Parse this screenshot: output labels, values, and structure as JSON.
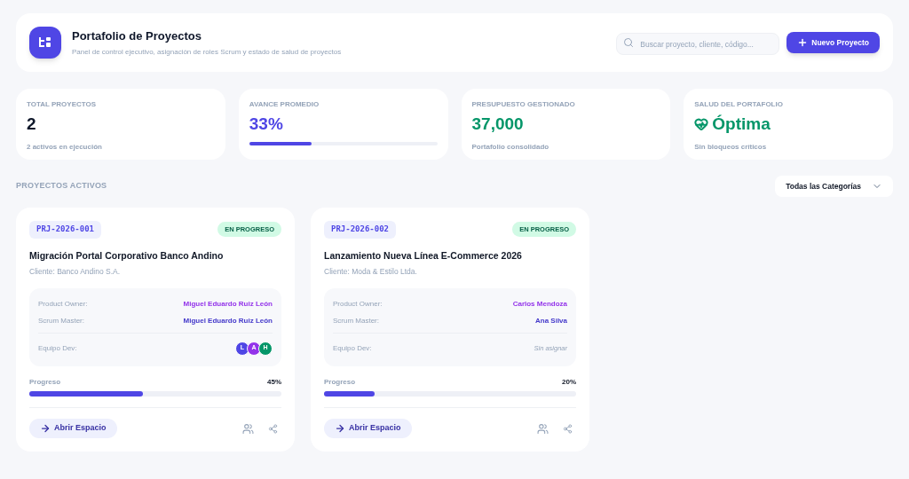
{
  "header": {
    "title": "Portafolio de Proyectos",
    "subtitle": "Panel de control ejecutivo, asignación de roles Scrum y estado de salud de proyectos",
    "search": {
      "placeholder": "Buscar proyecto, cliente, código..."
    },
    "new_button": "Nuevo Proyecto"
  },
  "stats": [
    {
      "kind": "plain",
      "label": "TOTAL PROYECTOS",
      "value": "2",
      "note": "2 activos en ejecución"
    },
    {
      "kind": "progress",
      "label": "AVANCE PROMEDIO",
      "value": "33%",
      "level": 0.33
    },
    {
      "kind": "money",
      "label": "PRESUPUESTO GESTIONADO",
      "value": "37,000",
      "note": "Portafolio consolidado"
    },
    {
      "kind": "health",
      "label": "SALUD DEL PORTAFOLIO",
      "value": "Óptima",
      "note": "Sin bloqueos críticos"
    }
  ],
  "section_title": "PROYECTOS ACTIVOS",
  "category_filter": "Todas las Categorías",
  "projects": [
    {
      "code": "PRJ-2026-001",
      "status": "EN PROGRESO",
      "name": "Migración Portal Corporativo Banco Andino",
      "client": "Cliente: Banco Andino S.A.",
      "roles": [
        {
          "label": "Product Owner:",
          "value": "Miguel Eduardo Ruiz León",
          "color": "#9333ea"
        },
        {
          "label": "Scrum Master:",
          "value": "Miguel Eduardo Ruiz León",
          "color": "#4338ca"
        }
      ],
      "team_label": "Equipo Dev:",
      "team": [
        {
          "initial": "L",
          "color": "#4f46e5"
        },
        {
          "initial": "A",
          "color": "#9333ea"
        },
        {
          "initial": "H",
          "color": "#059669"
        }
      ],
      "progress_label": "Progreso",
      "progress_text": "45%",
      "level": 0.45,
      "open_button": "Abrir Espacio"
    },
    {
      "code": "PRJ-2026-002",
      "status": "EN PROGRESO",
      "name": "Lanzamiento Nueva Línea E-Commerce 2026",
      "client": "Cliente: Moda & Estilo Ltda.",
      "roles": [
        {
          "label": "Product Owner:",
          "value": "Carlos Mendoza",
          "color": "#9333ea"
        },
        {
          "label": "Scrum Master:",
          "value": "Ana Silva",
          "color": "#4338ca"
        }
      ],
      "team_label": "Equipo Dev:",
      "team_note": "Sin asignar",
      "progress_label": "Progreso",
      "progress_text": "20%",
      "level": 0.2,
      "open_button": "Abrir Espacio"
    }
  ]
}
